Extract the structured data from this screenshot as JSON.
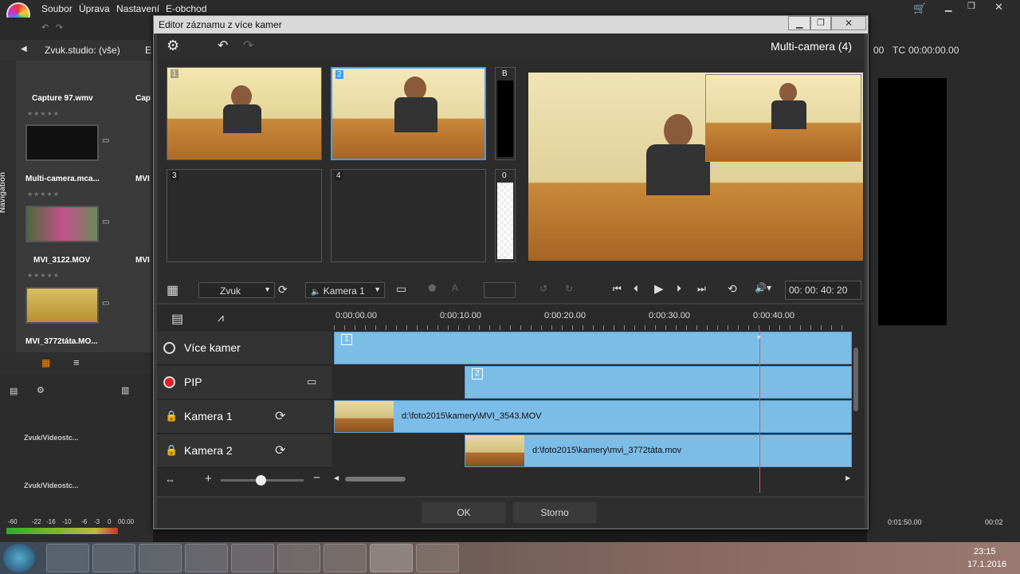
{
  "app": {
    "menu": [
      "Soubor",
      "Úprava",
      "Nastavení",
      "E-obchod"
    ],
    "library_tab": "Zvuk.studio: (vše)",
    "library_tab_more": "E",
    "nav_label": "Navigation",
    "library_items": [
      {
        "label": "Capture 97.wmv"
      },
      {
        "label": "Multi-camera.mca..."
      },
      {
        "label": "MVI_3122.MOV"
      },
      {
        "label": "MVI_3772táta.MO..."
      }
    ],
    "library_items_cut": [
      "Cap",
      "MVI",
      "MVI"
    ],
    "tracks": [
      "Zvuk/Videostc...",
      "Zvuk/Videostc..."
    ],
    "meter_scale": [
      "-60",
      "-22",
      "-16",
      "-10",
      "-6",
      "-3",
      "0"
    ],
    "left_time": "00.00",
    "right_tc_label": "TC",
    "right_tc_value": "00:00:00.00",
    "right_tc_prefix": "00",
    "bottom_times": [
      "0:01:50.00",
      "00:02"
    ]
  },
  "taskbar": {
    "time": "23:15",
    "date": "17.1.2016"
  },
  "dialog": {
    "title": "Editor záznamu z více kamer",
    "heading": "Multi-camera (4)",
    "cells": [
      {
        "num": "1"
      },
      {
        "num": "2"
      },
      {
        "num": "3"
      },
      {
        "num": "4"
      }
    ],
    "side_b": "B",
    "side_0": "0",
    "audio_dropdown": "Zvuk",
    "camera_dropdown": "Kamera 1",
    "timecode": "00: 00: 40: 20",
    "ruler": [
      "0:00:00.00",
      "0:00:10.00",
      "0:00:20.00",
      "0:00:30.00",
      "0:00:40.00"
    ],
    "tracks": [
      {
        "name": "Více kamer",
        "clip_num": "1"
      },
      {
        "name": "PIP",
        "clip_num": "2"
      },
      {
        "name": "Kamera 1",
        "clip_label": "d:\\foto2015\\kamery\\MVI_3543.MOV"
      },
      {
        "name": "Kamera 2",
        "clip_label": "d:\\foto2015\\kamery\\mvi_3772táta.mov"
      }
    ],
    "ok_label": "OK",
    "cancel_label": "Storno"
  },
  "colors": {
    "clip_blue": "#7cbde8",
    "selected_border": "#3aa0ff",
    "playhead": "#e05060",
    "record_red": "#e0202a"
  }
}
